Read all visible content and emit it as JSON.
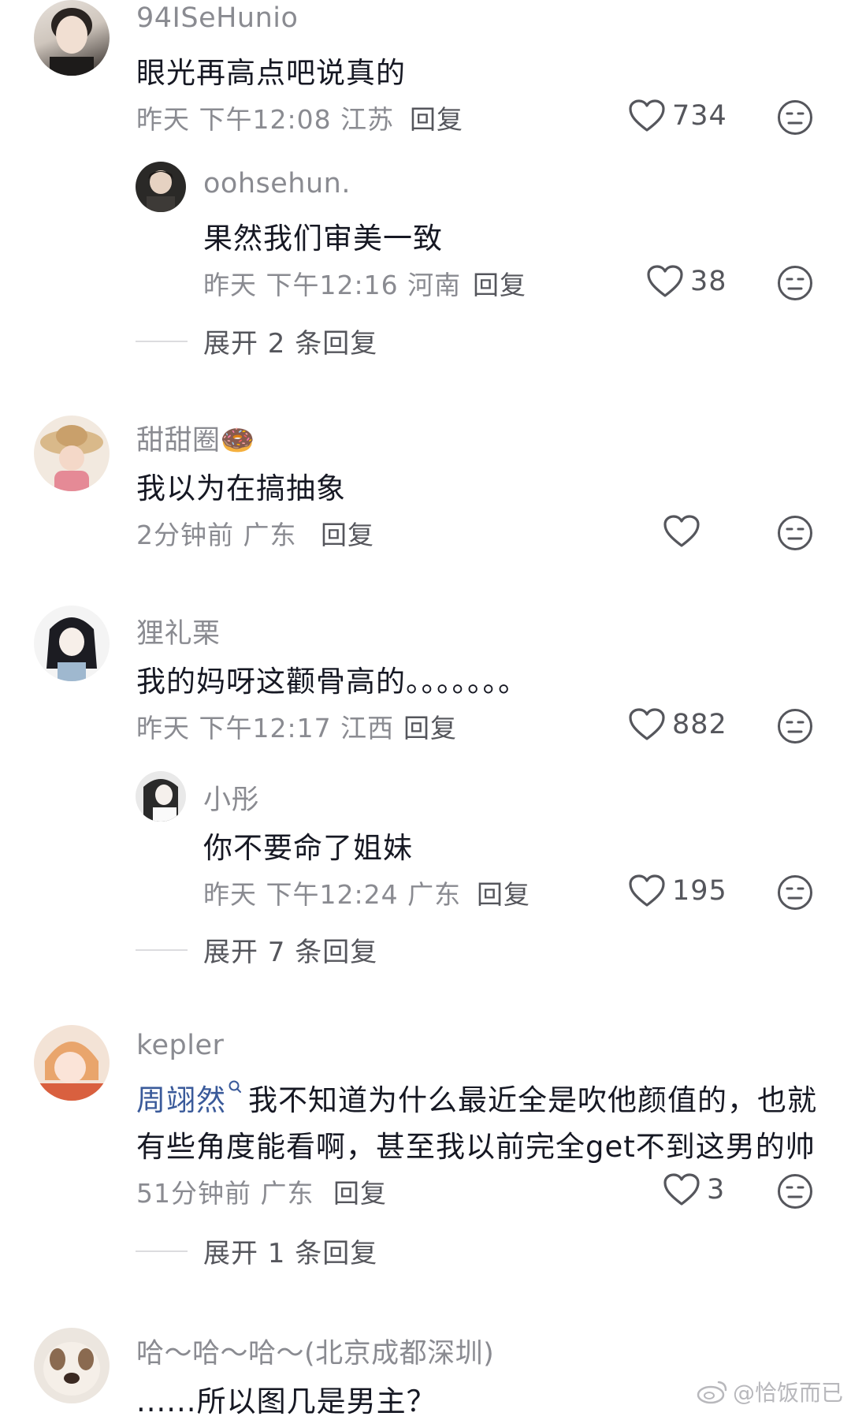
{
  "comments": [
    {
      "username": "94ISeHunio",
      "text": "眼光再高点吧说真的",
      "meta": "昨天 下午12:08 江苏",
      "reply_label": "回复",
      "likes": "734",
      "replies": [
        {
          "username": "oohsehun.",
          "text": "果然我们审美一致",
          "meta": "昨天 下午12:16 河南",
          "reply_label": "回复",
          "likes": "38"
        }
      ],
      "expand_label": "展开 2 条回复"
    },
    {
      "username": "甜甜圈",
      "username_emoji": "🍩",
      "text": "我以为在搞抽象",
      "meta": "2分钟前 广东",
      "reply_label": "回复",
      "likes": ""
    },
    {
      "username": "狸礼栗",
      "text": "我的妈呀这颧骨高的。。。。。。。",
      "meta": "昨天 下午12:17 江西",
      "reply_label": "回复",
      "likes": "882",
      "replies": [
        {
          "username": "小彤",
          "text": "你不要命了姐妹",
          "meta": "昨天 下午12:24 广东",
          "reply_label": "回复",
          "likes": "195"
        }
      ],
      "expand_label": "展开 7 条回复"
    },
    {
      "username": "kepler",
      "mention": "周翊然",
      "text_line1": "我不知道为什么最近全是吹他颜值的，也就",
      "text_line2": "有些角度能看啊，甚至我以前完全get不到这男的帅",
      "meta": "51分钟前 广东",
      "reply_label": "回复",
      "likes": "3",
      "expand_label": "展开 1 条回复"
    },
    {
      "username": "哈～哈～哈～(北京成都深圳)",
      "text": "......所以图几是男主？"
    }
  ],
  "watermark": "@恰饭而已",
  "icons": [
    "heart-icon",
    "dislike-face-icon",
    "search-icon",
    "weibo-logo-icon"
  ],
  "colors": {
    "mention": "#3a5a9a",
    "meta": "#8a8b91",
    "text": "#161823"
  }
}
